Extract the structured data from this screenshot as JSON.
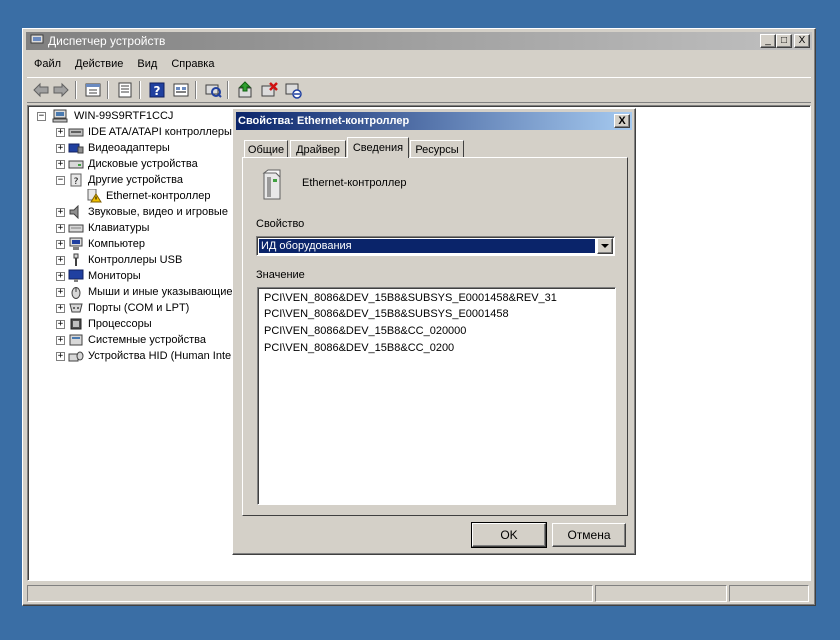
{
  "main_window": {
    "title": "Диспетчер устройств",
    "title_buttons": {
      "minimize": "_",
      "maximize": "□",
      "close": "X"
    }
  },
  "menu": [
    "Файл",
    "Действие",
    "Вид",
    "Справка"
  ],
  "toolbar": [
    "back-icon",
    "forward-icon",
    "properties-view-icon",
    "list-icon",
    "help-icon",
    "details-icon",
    "scan-hardware-icon",
    "update-driver-icon",
    "uninstall-icon",
    "disable-icon"
  ],
  "tree": {
    "root": "WIN-99S9RTF1CCJ",
    "items": [
      {
        "label": "IDE ATA/ATAPI контроллеры",
        "icon": "ide-controller-icon",
        "expander": "+"
      },
      {
        "label": "Видеоадаптеры",
        "icon": "display-adapter-icon",
        "expander": "+"
      },
      {
        "label": "Дисковые устройства",
        "icon": "disk-drive-icon",
        "expander": "+"
      },
      {
        "label": "Другие устройства",
        "icon": "other-devices-icon",
        "expander": "−"
      },
      {
        "label": "Ethernet-контроллер",
        "icon": "warning-device-icon",
        "expander": "",
        "child": true
      },
      {
        "label": "Звуковые, видео и игровые",
        "icon": "sound-icon",
        "expander": "+"
      },
      {
        "label": "Клавиатуры",
        "icon": "keyboard-icon",
        "expander": "+"
      },
      {
        "label": "Компьютер",
        "icon": "computer-icon",
        "expander": "+"
      },
      {
        "label": "Контроллеры USB",
        "icon": "usb-icon",
        "expander": "+"
      },
      {
        "label": "Мониторы",
        "icon": "monitor-icon",
        "expander": "+"
      },
      {
        "label": "Мыши и иные указывающие",
        "icon": "mouse-icon",
        "expander": "+"
      },
      {
        "label": "Порты (COM и LPT)",
        "icon": "port-icon",
        "expander": "+"
      },
      {
        "label": "Процессоры",
        "icon": "processor-icon",
        "expander": "+"
      },
      {
        "label": "Системные устройства",
        "icon": "system-device-icon",
        "expander": "+"
      },
      {
        "label": "Устройства HID (Human Inte",
        "icon": "hid-icon",
        "expander": "+"
      }
    ]
  },
  "dialog": {
    "title": "Свойства: Ethernet-контроллер",
    "close": "X",
    "tabs": [
      "Общие",
      "Драйвер",
      "Сведения",
      "Ресурсы"
    ],
    "active_tab": "Сведения",
    "device_name": "Ethernet-контроллер",
    "property_label": "Свойство",
    "property_value": "ИД оборудования",
    "value_label": "Значение",
    "values": [
      "PCI\\VEN_8086&DEV_15B8&SUBSYS_E0001458&REV_31",
      "PCI\\VEN_8086&DEV_15B8&SUBSYS_E0001458",
      "PCI\\VEN_8086&DEV_15B8&CC_020000",
      "PCI\\VEN_8086&DEV_15B8&CC_0200"
    ],
    "ok": "OK",
    "cancel": "Отмена"
  },
  "colors": {
    "desktop": "#3a6ea5",
    "active_title": "#0a246a",
    "inactive_title": "#808080",
    "face": "#d4d0c8"
  }
}
